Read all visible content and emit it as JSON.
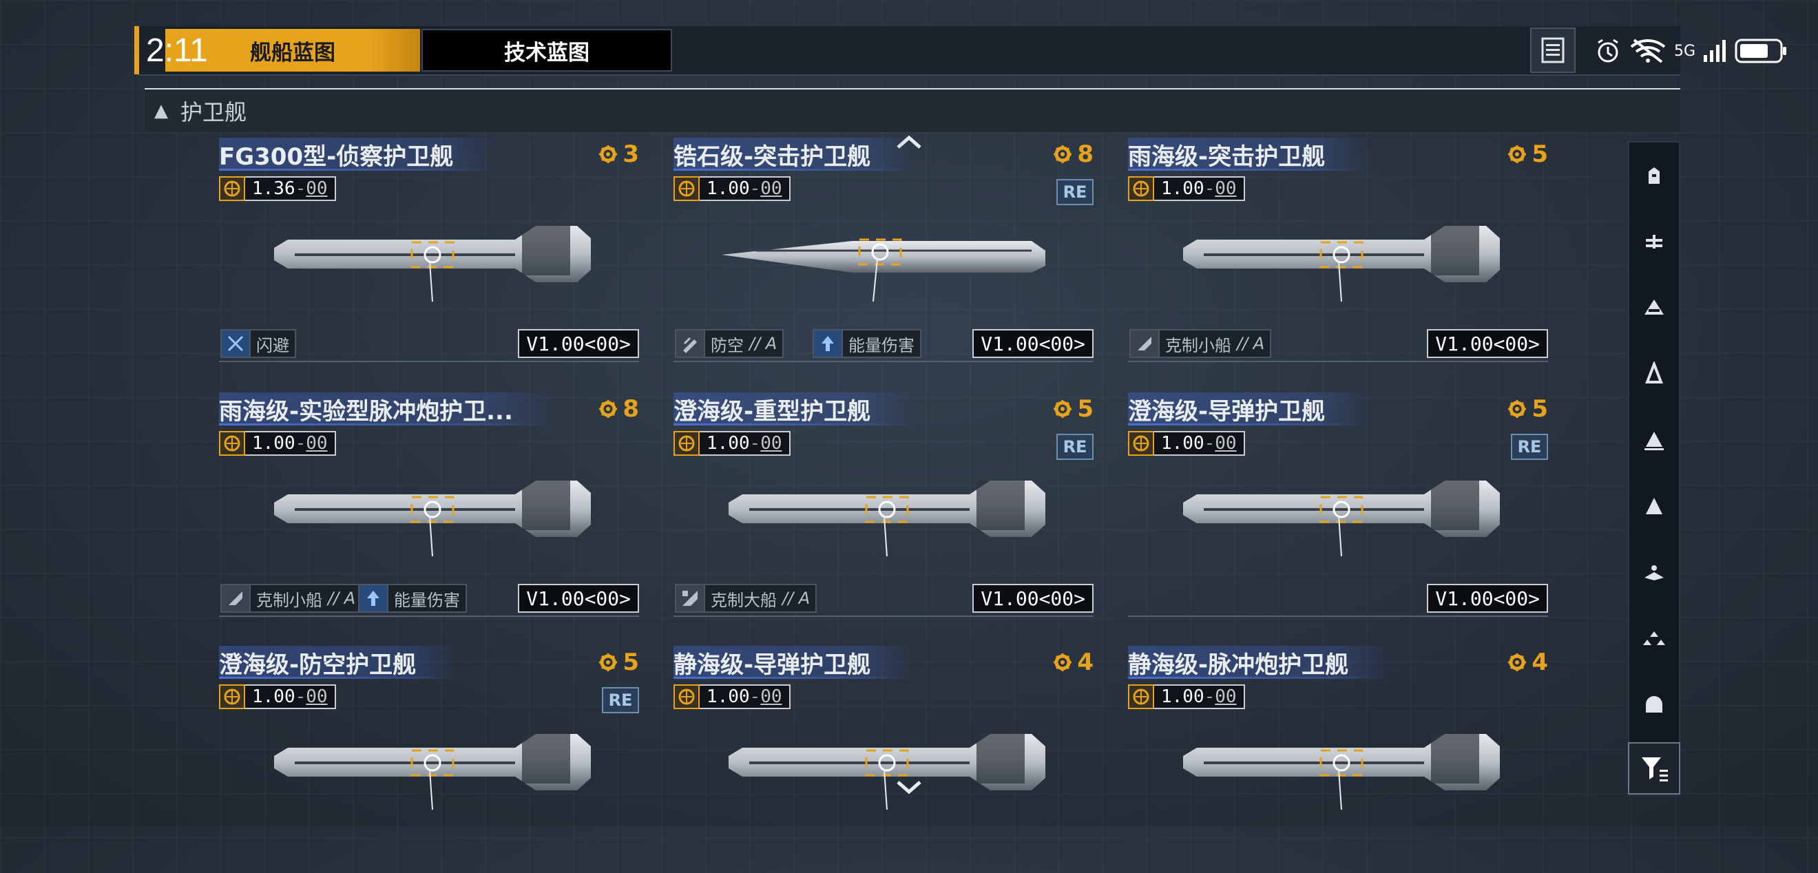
{
  "status": {
    "time": "2:11",
    "network": "5G"
  },
  "tabs": {
    "ship": "舰船蓝图",
    "tech": "技术蓝图"
  },
  "section": {
    "label": "护卫舰"
  },
  "cards": [
    {
      "name": "FG300型-侦察护卫舰",
      "cost": "3",
      "version_num": "1.36",
      "version_sub": "00",
      "re": "",
      "traits": [
        {
          "label": "闪避",
          "grade": "",
          "icon": "dodge-icon"
        }
      ],
      "badge": "V1.00<00>"
    },
    {
      "name": "锆石级-突击护卫舰",
      "cost": "8",
      "version_num": "1.00",
      "version_sub": "00",
      "re": "RE",
      "traits": [
        {
          "label": "防空",
          "grade": "// A",
          "icon": "anti-air-icon"
        },
        {
          "label": "能量伤害",
          "grade": "",
          "icon": "energy-damage-icon"
        }
      ],
      "badge": "V1.00<00>"
    },
    {
      "name": "雨海级-突击护卫舰",
      "cost": "5",
      "version_num": "1.00",
      "version_sub": "00",
      "re": "",
      "traits": [
        {
          "label": "克制小船",
          "grade": "// A",
          "icon": "counter-small-icon"
        }
      ],
      "badge": "V1.00<00>"
    },
    {
      "name": "雨海级-实验型脉冲炮护卫...",
      "cost": "8",
      "version_num": "1.00",
      "version_sub": "00",
      "re": "",
      "traits": [
        {
          "label": "克制小船",
          "grade": "// A",
          "icon": "counter-small-icon"
        },
        {
          "label": "能量伤害",
          "grade": "",
          "icon": "energy-damage-icon"
        }
      ],
      "badge": "V1.00<00>"
    },
    {
      "name": "澄海级-重型护卫舰",
      "cost": "5",
      "version_num": "1.00",
      "version_sub": "00",
      "re": "RE",
      "traits": [
        {
          "label": "克制大船",
          "grade": "// A",
          "icon": "counter-large-icon"
        }
      ],
      "badge": "V1.00<00>"
    },
    {
      "name": "澄海级-导弹护卫舰",
      "cost": "5",
      "version_num": "1.00",
      "version_sub": "00",
      "re": "RE",
      "traits": [],
      "badge": "V1.00<00>"
    },
    {
      "name": "澄海级-防空护卫舰",
      "cost": "5",
      "version_num": "1.00",
      "version_sub": "00",
      "re": "RE",
      "traits": [],
      "badge": ""
    },
    {
      "name": "静海级-导弹护卫舰",
      "cost": "4",
      "version_num": "1.00",
      "version_sub": "00",
      "re": "",
      "traits": [],
      "badge": ""
    },
    {
      "name": "静海级-脉冲炮护卫舰",
      "cost": "4",
      "version_num": "1.00",
      "version_sub": "00",
      "re": "",
      "traits": [],
      "badge": ""
    }
  ],
  "rail_icons": [
    "carrier-icon",
    "battlecruiser-icon",
    "cruiser-icon",
    "destroyer-icon",
    "frigate-icon",
    "corvette-icon",
    "fighter-icon",
    "squadron-icon",
    "aux-icon"
  ],
  "colors": {
    "accent": "#e8a31d",
    "panel": "#1b222b",
    "re_blue": "#6b8fb0",
    "name_band": "#3c5aaa"
  }
}
